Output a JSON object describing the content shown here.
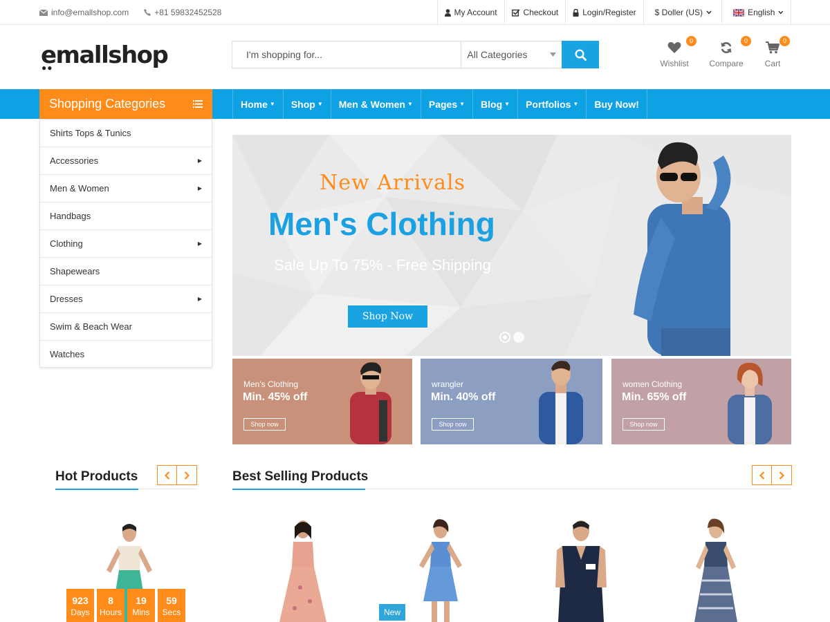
{
  "topbar": {
    "email": "info@emallshop.com",
    "phone": "+81 59832452528",
    "my_account": "My Account",
    "checkout": "Checkout",
    "login_register": "Login/Register",
    "currency": "$ Doller (US)",
    "language": "English"
  },
  "header": {
    "logo": "emallshop",
    "search_placeholder": "I'm shopping for...",
    "category_select": "All Categories",
    "wishlist": {
      "label": "Wishlist",
      "count": "0"
    },
    "compare": {
      "label": "Compare",
      "count": "0"
    },
    "cart": {
      "label": "Cart",
      "count": "0"
    }
  },
  "nav": {
    "categories_title": "Shopping Categories",
    "menu": [
      "Home",
      "Shop",
      "Men & Women",
      "Pages",
      "Blog",
      "Portfolios",
      "Buy Now!"
    ]
  },
  "categories": [
    "Shirts Tops & Tunics",
    "Accessories",
    "Men & Women",
    "Handbags",
    "Clothing",
    "Shapewears",
    "Dresses",
    "Swim & Beach Wear",
    "Watches"
  ],
  "hero": {
    "kicker": "New Arrivals",
    "title": "Men's Clothing",
    "subtitle": "Sale Up To 75% - Free Shipping",
    "button": "Shop Now"
  },
  "promos": [
    {
      "line1": "Men's Clothing",
      "line2": "Min. 45% off",
      "button": "Shop now",
      "color": "#c9917a"
    },
    {
      "line1": "wrangler",
      "line2": "Min. 40% off",
      "button": "Shop now",
      "color": "#8c9fc3"
    },
    {
      "line1": "women Clothing",
      "line2": "Min. 65% off",
      "button": "Shop now",
      "color": "#c2a1a6"
    }
  ],
  "sections": {
    "hot": "Hot Products",
    "best": "Best Selling Products"
  },
  "countdown": [
    {
      "value": "923",
      "unit": "Days"
    },
    {
      "value": "8",
      "unit": "Hours"
    },
    {
      "value": "19",
      "unit": "Mins"
    },
    {
      "value": "59",
      "unit": "Secs"
    }
  ],
  "new_badge": "New",
  "colors": {
    "primary": "#19a3e3",
    "accent": "#ff8c1a"
  }
}
